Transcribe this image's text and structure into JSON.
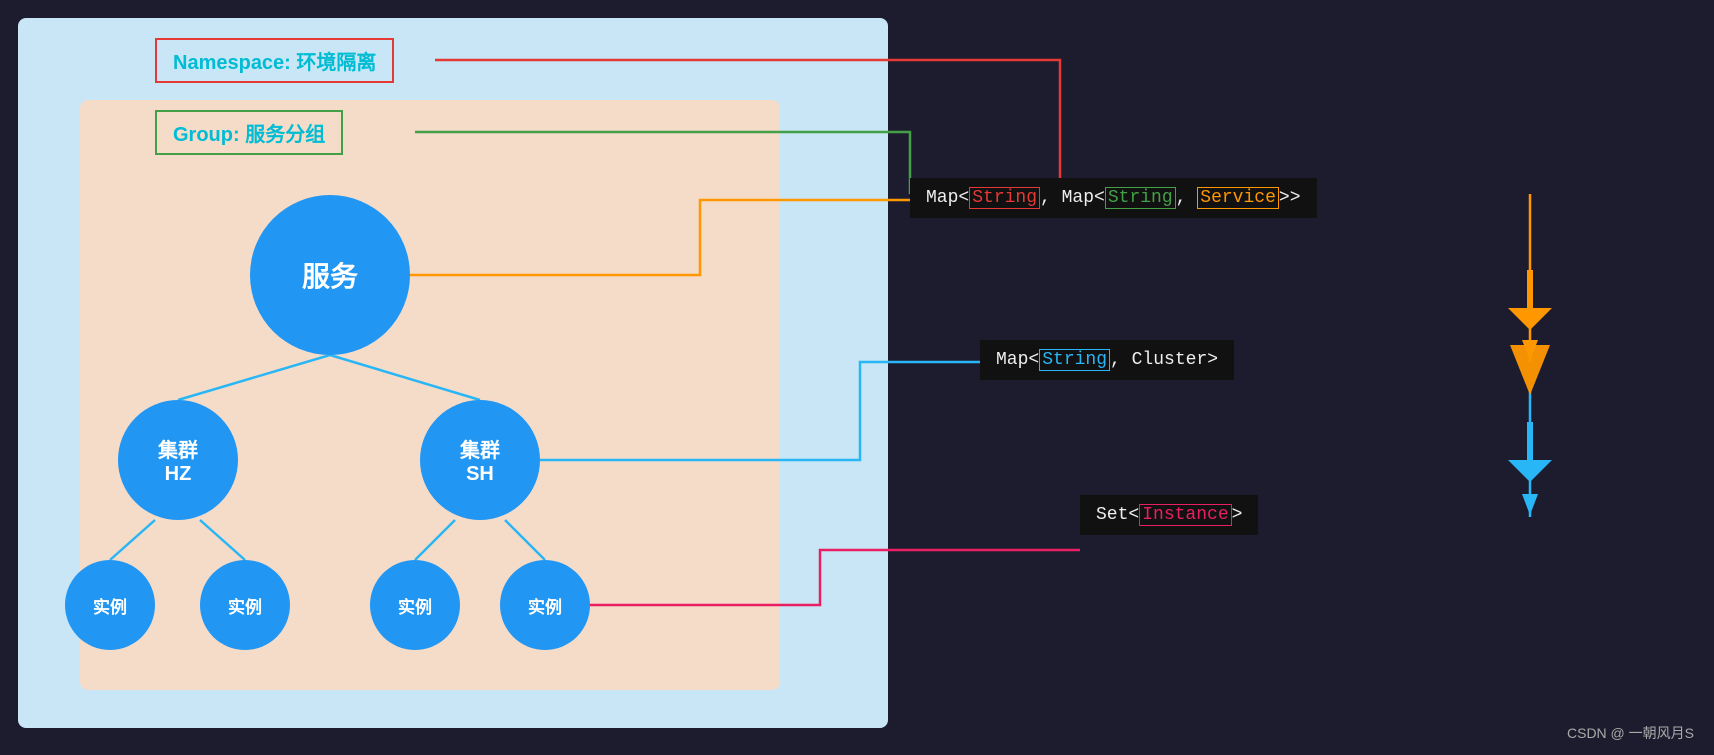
{
  "background": {
    "lightBlue": "#c8e6f5",
    "peach": "#f5dcc8",
    "dark": "#1c1c2e"
  },
  "labels": {
    "namespace": "Namespace: 环境隔离",
    "group": "Group: 服务分组",
    "service": "服务",
    "clusterHZ": "集群\nHZ",
    "clusterSH": "集群\nSH",
    "instance": "实例",
    "mapStringMapStringService": "Map<String, Map<String, Service>>",
    "mapStringCluster": "Map<String, Cluster>",
    "setInstance": "Set<Instance>",
    "watermark": "CSDN @ 一朝风月S"
  },
  "colors": {
    "red": "#e53935",
    "green": "#43a047",
    "orange": "#ff9800",
    "blue": "#2196F3",
    "lightBlue": "#29b6f6",
    "magenta": "#e91e63",
    "cyan": "#00bcd4"
  }
}
